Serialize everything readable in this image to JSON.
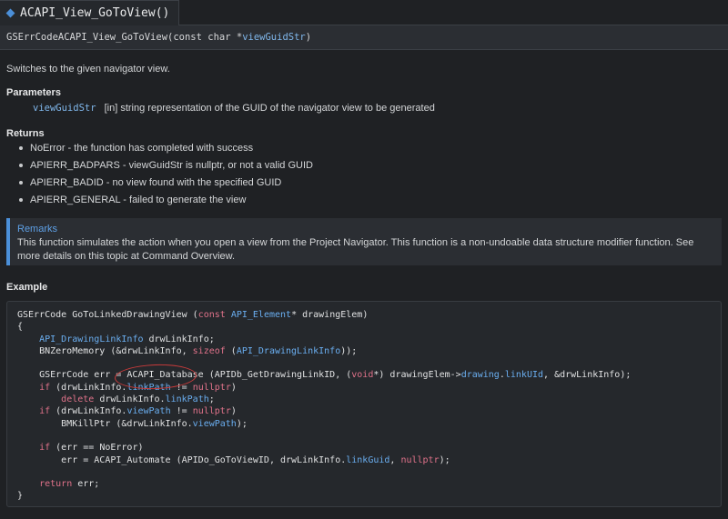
{
  "tab": {
    "title": "ACAPI_View_GoToView()"
  },
  "signature": {
    "return_type": "GSErrCode",
    "func_name": "ACAPI_View_GoToView",
    "open": "(",
    "param_type": "const char *",
    "param_name": "viewGuidStr",
    "close": ")"
  },
  "description": "Switches to the given navigator view.",
  "parameters": {
    "heading": "Parameters",
    "items": [
      {
        "name": "viewGuidStr",
        "desc": "[in] string representation of the GUID of the navigator view to be generated"
      }
    ]
  },
  "returns": {
    "heading": "Returns",
    "items": [
      "NoError - the function has completed with success",
      "APIERR_BADPARS - viewGuidStr is nullptr, or not a valid GUID",
      "APIERR_BADID - no view found with the specified GUID",
      "APIERR_GENERAL - failed to generate the view"
    ]
  },
  "remarks": {
    "title": "Remarks",
    "body": "This function simulates the action when you open a view from the Project Navigator. This function is a non-undoable data structure modifier function. See more details on this topic at Command Overview."
  },
  "example": {
    "heading": "Example",
    "lines": [
      [
        [
          "GSErrCode GoToLinkedDrawingView (",
          "p"
        ],
        [
          "const",
          "k"
        ],
        [
          " ",
          "p"
        ],
        [
          "API_Element",
          "t"
        ],
        [
          "* drawingElem)",
          "p"
        ]
      ],
      [
        [
          "{",
          "p"
        ]
      ],
      [
        [
          "    ",
          "p"
        ],
        [
          "API_DrawingLinkInfo",
          "t"
        ],
        [
          " drwLinkInfo;",
          "p"
        ]
      ],
      [
        [
          "    BNZeroMemory (&drwLinkInfo, ",
          "p"
        ],
        [
          "sizeof",
          "k"
        ],
        [
          " (",
          "p"
        ],
        [
          "API_DrawingLinkInfo",
          "t"
        ],
        [
          "));",
          "p"
        ]
      ],
      [
        [
          "",
          "p"
        ]
      ],
      [
        [
          "    GSErrCode err = ACAPI_Database (APIDb_GetDrawingLinkID, (",
          "p"
        ],
        [
          "void",
          "k"
        ],
        [
          "*) drawingElem->",
          "p"
        ],
        [
          "drawing",
          "m"
        ],
        [
          ".",
          "p"
        ],
        [
          "linkUId",
          "m"
        ],
        [
          ", &drwLinkInfo);",
          "p"
        ]
      ],
      [
        [
          "    ",
          "p"
        ],
        [
          "if",
          "k"
        ],
        [
          " (drwLinkInfo.",
          "p"
        ],
        [
          "linkPath",
          "m"
        ],
        [
          " != ",
          "p"
        ],
        [
          "nullptr",
          "k"
        ],
        [
          ")",
          "p"
        ]
      ],
      [
        [
          "        ",
          "p"
        ],
        [
          "delete",
          "k"
        ],
        [
          " drwLinkInfo.",
          "p"
        ],
        [
          "linkPath",
          "m"
        ],
        [
          ";",
          "p"
        ]
      ],
      [
        [
          "    ",
          "p"
        ],
        [
          "if",
          "k"
        ],
        [
          " (drwLinkInfo.",
          "p"
        ],
        [
          "viewPath",
          "m"
        ],
        [
          " != ",
          "p"
        ],
        [
          "nullptr",
          "k"
        ],
        [
          ")",
          "p"
        ]
      ],
      [
        [
          "        BMKillPtr (&drwLinkInfo.",
          "p"
        ],
        [
          "viewPath",
          "m"
        ],
        [
          ");",
          "p"
        ]
      ],
      [
        [
          "",
          "p"
        ]
      ],
      [
        [
          "    ",
          "p"
        ],
        [
          "if",
          "k"
        ],
        [
          " (err == NoError)",
          "p"
        ]
      ],
      [
        [
          "        err = ACAPI_Automate (APIDo_GoToViewID, drwLinkInfo.",
          "p"
        ],
        [
          "linkGuid",
          "m"
        ],
        [
          ", ",
          "p"
        ],
        [
          "nullptr",
          "k"
        ],
        [
          ");",
          "p"
        ]
      ],
      [
        [
          "",
          "p"
        ]
      ],
      [
        [
          "    ",
          "p"
        ],
        [
          "return",
          "k"
        ],
        [
          " err;",
          "p"
        ]
      ],
      [
        [
          "}",
          "p"
        ]
      ]
    ]
  }
}
